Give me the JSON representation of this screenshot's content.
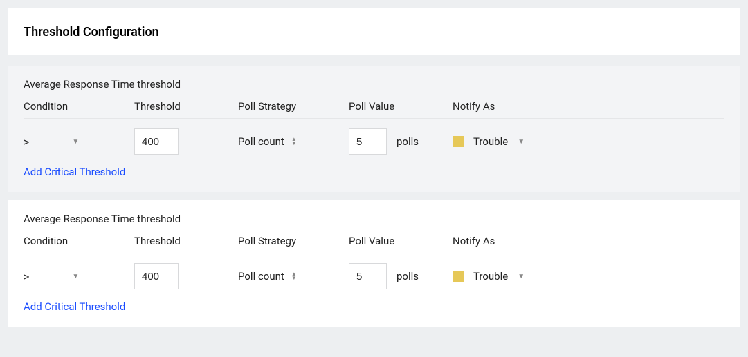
{
  "header": {
    "title": "Threshold Configuration"
  },
  "columns": {
    "condition": "Condition",
    "threshold": "Threshold",
    "poll_strategy": "Poll Strategy",
    "poll_value": "Poll Value",
    "notify_as": "Notify As"
  },
  "blocks": [
    {
      "title": "Average Response Time threshold",
      "condition_symbol": ">",
      "threshold_value": "400",
      "poll_strategy_label": "Poll count",
      "poll_value": "5",
      "poll_unit": "polls",
      "notify_color": "#e6c858",
      "notify_label": "Trouble",
      "add_link": "Add Critical Threshold"
    },
    {
      "title": "Average Response Time threshold",
      "condition_symbol": ">",
      "threshold_value": "400",
      "poll_strategy_label": "Poll count",
      "poll_value": "5",
      "poll_unit": "polls",
      "notify_color": "#e6c858",
      "notify_label": "Trouble",
      "add_link": "Add Critical Threshold"
    }
  ]
}
